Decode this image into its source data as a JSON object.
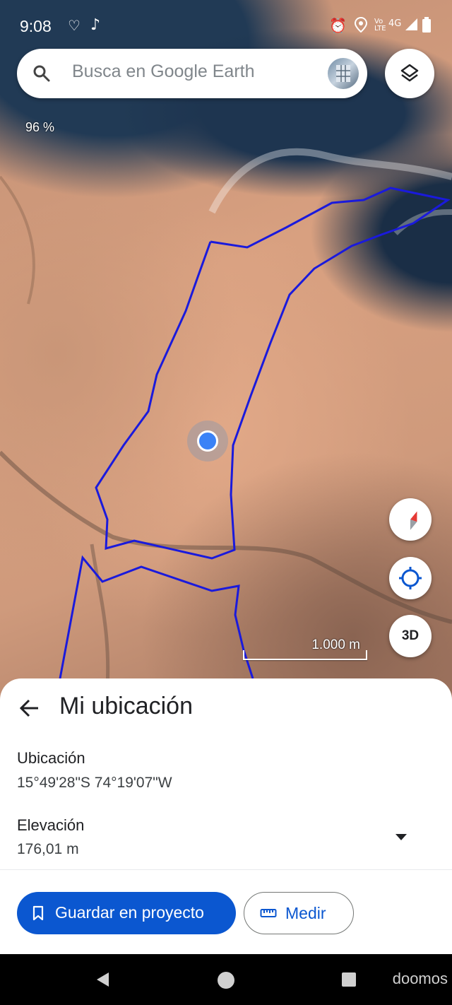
{
  "status_bar": {
    "time": "9:08",
    "network": "4G",
    "volte": "Vo LTE"
  },
  "search": {
    "placeholder": "Busca en Google Earth"
  },
  "map": {
    "compass_percent": "96 %",
    "scale_label": "1.000 m",
    "btn_3d": "3D"
  },
  "sheet": {
    "title": "Mi ubicación",
    "location_label": "Ubicación",
    "location_value": "15°49'28\"S 74°19'07\"W",
    "elevation_label": "Elevación",
    "elevation_value": "176,01 m",
    "save_button": "Guardar en proyecto",
    "measure_button": "Medir"
  },
  "watermark": "doomos",
  "colors": {
    "accent": "#0b57d0",
    "polygon": "#1a1adc",
    "location_dot": "#3b82f6"
  }
}
